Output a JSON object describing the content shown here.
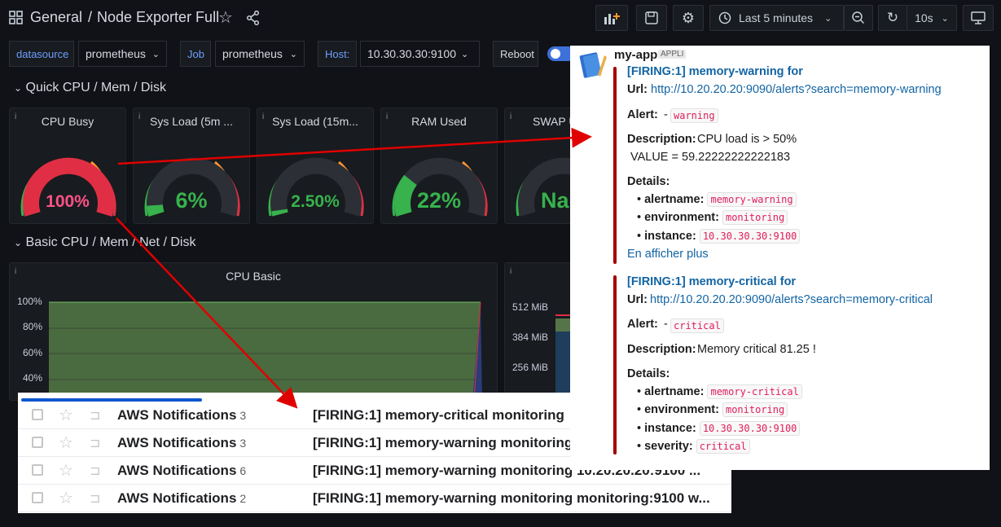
{
  "topbar": {
    "section": "General",
    "separator": "/",
    "dashboard": "Node Exporter Full",
    "time_range": "Last 5 minutes",
    "refresh": "10s"
  },
  "variables": [
    {
      "label": "datasource",
      "value": "prometheus"
    },
    {
      "label": "Job",
      "value": "prometheus"
    },
    {
      "label": "Host:",
      "value": "10.30.30.30:9100"
    }
  ],
  "reboot_label": "Reboot",
  "rows": {
    "quick": "Quick CPU / Mem / Disk",
    "basic": "Basic CPU / Mem / Net / Disk"
  },
  "gauges": [
    {
      "title": "CPU Busy",
      "value": "100%",
      "fraction": 1.0,
      "color": "#e02f44"
    },
    {
      "title": "Sys Load (5m ...",
      "value": "6%",
      "fraction": 0.06,
      "color": "#37b24d"
    },
    {
      "title": "Sys Load (15m...",
      "value": "2.50%",
      "fraction": 0.025,
      "color": "#37b24d"
    },
    {
      "title": "RAM Used",
      "value": "22%",
      "fraction": 0.22,
      "color": "#37b24d"
    },
    {
      "title": "SWAP U",
      "value": "Na",
      "fraction": 0,
      "color": "#37b24d"
    }
  ],
  "cpu_basic": {
    "title": "CPU Basic",
    "yticks": [
      "100%",
      "80%",
      "60%",
      "40%"
    ]
  },
  "mem_basic": {
    "yticks": [
      "512 MiB",
      "384 MiB",
      "256 MiB"
    ]
  },
  "slack": {
    "app_name": "my-app",
    "app_badge": "APPLI",
    "alerts": [
      {
        "title": "[FIRING:1] memory-warning for",
        "url_label": "Url:",
        "url": "http://10.20.20.20:9090/alerts?search=memory-warning",
        "alert_label": "Alert:",
        "alert_dash": "-",
        "alert_tag": "warning",
        "desc_label": "Description:",
        "description": "CPU load is > 50%",
        "value_line": "VALUE = 59.22222222222183",
        "details_label": "Details:",
        "details": [
          {
            "key": "alertname:",
            "val": "memory-warning"
          },
          {
            "key": "environment:",
            "val": "monitoring"
          },
          {
            "key": "instance:",
            "val": "10.30.30.30:9100"
          }
        ],
        "more": "En afficher plus"
      },
      {
        "title": "[FIRING:1] memory-critical for",
        "url_label": "Url:",
        "url": "http://10.20.20.20:9090/alerts?search=memory-critical",
        "alert_label": "Alert:",
        "alert_dash": "-",
        "alert_tag": "critical",
        "desc_label": "Description:",
        "description": "Memory critical 81.25 !",
        "details_label": "Details:",
        "details": [
          {
            "key": "alertname:",
            "val": "memory-critical"
          },
          {
            "key": "environment:",
            "val": "monitoring"
          },
          {
            "key": "instance:",
            "val": "10.30.30.30:9100"
          },
          {
            "key": "severity:",
            "val": "critical"
          }
        ]
      }
    ]
  },
  "gmail": {
    "rows": [
      {
        "sender": "AWS Notifications",
        "count": "3",
        "subject": "[FIRING:1] memory-critical monitoring"
      },
      {
        "sender": "AWS Notifications",
        "count": "3",
        "subject": "[FIRING:1] memory-warning monitoring"
      },
      {
        "sender": "AWS Notifications",
        "count": "6",
        "subject": "[FIRING:1] memory-warning monitoring 10.20.20.20:9100 ..."
      },
      {
        "sender": "AWS Notifications",
        "count": "2",
        "subject": "[FIRING:1] memory-warning monitoring monitoring:9100 w..."
      }
    ]
  },
  "colors": {
    "grafana_bg": "#111217",
    "panel_bg": "#181b1f",
    "link_blue": "#1264a3",
    "alert_bar": "#a30200",
    "arrow_red": "#e00000"
  }
}
